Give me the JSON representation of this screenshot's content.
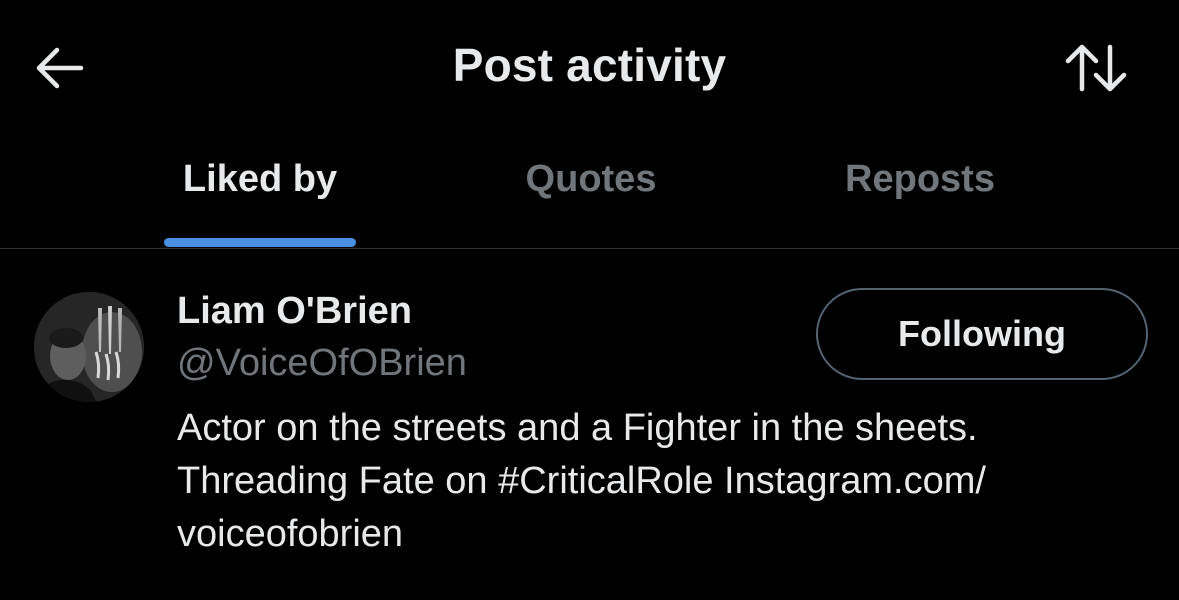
{
  "header": {
    "title": "Post activity",
    "back_icon": "arrow-left-icon",
    "sort_icon": "sort-arrows-icon"
  },
  "tabs": [
    {
      "label": "Liked by",
      "active": true
    },
    {
      "label": "Quotes",
      "active": false
    },
    {
      "label": "Reposts",
      "active": false
    }
  ],
  "users": [
    {
      "display_name": "Liam O'Brien",
      "handle": "@VoiceOfOBrien",
      "follow_label": "Following",
      "bio_lines": [
        "Actor on the streets and a Fighter in the sheets.",
        "Threading Fate on #CriticalRole Instagram.com/",
        "voiceofobrien"
      ]
    }
  ],
  "colors": {
    "background": "#000000",
    "primary_text": "#e7e9ea",
    "secondary_text": "#71767b",
    "tab_indicator": "#4a90e2",
    "divider": "#2f3336",
    "button_border": "#536471"
  }
}
